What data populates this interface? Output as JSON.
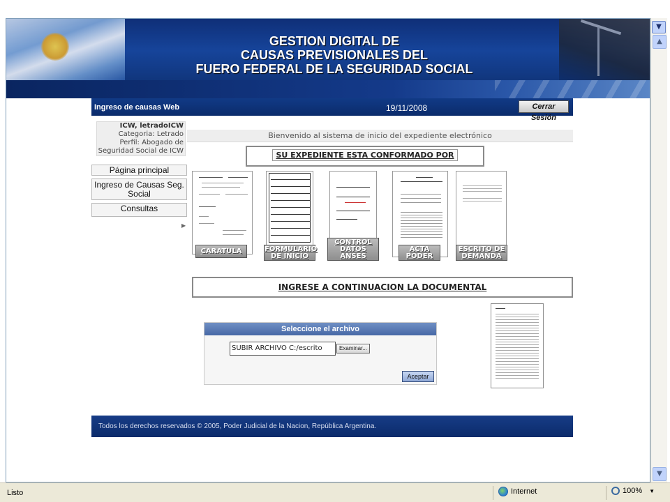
{
  "header": {
    "title_lines": [
      "GESTION DIGITAL DE",
      "CAUSAS PREVISIONALES DEL",
      "FUERO FEDERAL DE LA SEGURIDAD SOCIAL"
    ]
  },
  "app": {
    "name": "Ingreso de causas Web",
    "date": "19/11/2008",
    "logout_label": "Cerrar Sesión"
  },
  "user": {
    "name": "ICW, letradoICW",
    "category": "Categoria: Letrado",
    "profile": "Perfil: Abogado de",
    "profile_cont": "Seguridad Social de ICW"
  },
  "nav": {
    "home": "Página principal",
    "ingreso_line1": "Ingreso de Causas Seg.",
    "ingreso_line2": "Social",
    "consultas": "Consultas"
  },
  "main": {
    "welcome": "Bienvenido al sistema de inicio del expediente electrónico",
    "expediente_title": "SU EXPEDIENTE ESTA CONFORMADO POR",
    "documents": [
      {
        "line1": "CARATULA",
        "line2": ""
      },
      {
        "line1": "FORMULARIO",
        "line2": "DE INICIO"
      },
      {
        "line1": "CONTROL",
        "line2": "DATOS ANSES"
      },
      {
        "line1": "ACTA",
        "line2": "PODER"
      },
      {
        "line1": "ESCRITO DE",
        "line2": "DEMANDA"
      }
    ],
    "documental_title": "INGRESE A CONTINUACION LA DOCUMENTAL",
    "upload": {
      "header": "Seleccione el archivo",
      "input_value": "SUBIR ARCHIVO C:/escrito",
      "browse_label": "Examinar...",
      "accept_label": "Aceptar"
    }
  },
  "footer": {
    "text": "Todos los derechos reservados © 2005, Poder Judicial de la Nacion, República Argentina."
  },
  "statusbar": {
    "status": "Listo",
    "zone": "Internet",
    "zoom": "100%"
  }
}
